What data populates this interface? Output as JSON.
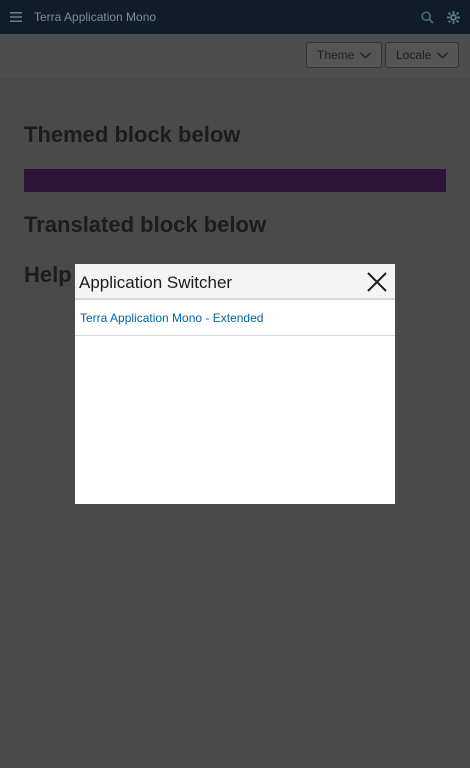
{
  "header": {
    "app_title": "Terra Application Mono",
    "menu_icon": "hamburger-menu-icon",
    "search_icon": "search-icon",
    "utility_icon": "gear-icon"
  },
  "toolbar": {
    "theme_label": "Theme",
    "locale_label": "Locale"
  },
  "main": {
    "themed_heading": "Themed block below",
    "translated_heading": "Translated block below",
    "help_heading": "Help",
    "themed_block_color": "#6b2a8a"
  },
  "modal": {
    "title": "Application Switcher",
    "close_icon": "close-icon",
    "items": [
      {
        "label": "Terra Application Mono - Extended"
      }
    ]
  },
  "colors": {
    "topbar": "#1d3a4f",
    "link": "#0065a6",
    "overlay": "rgba(0,0,0,0.7)"
  }
}
